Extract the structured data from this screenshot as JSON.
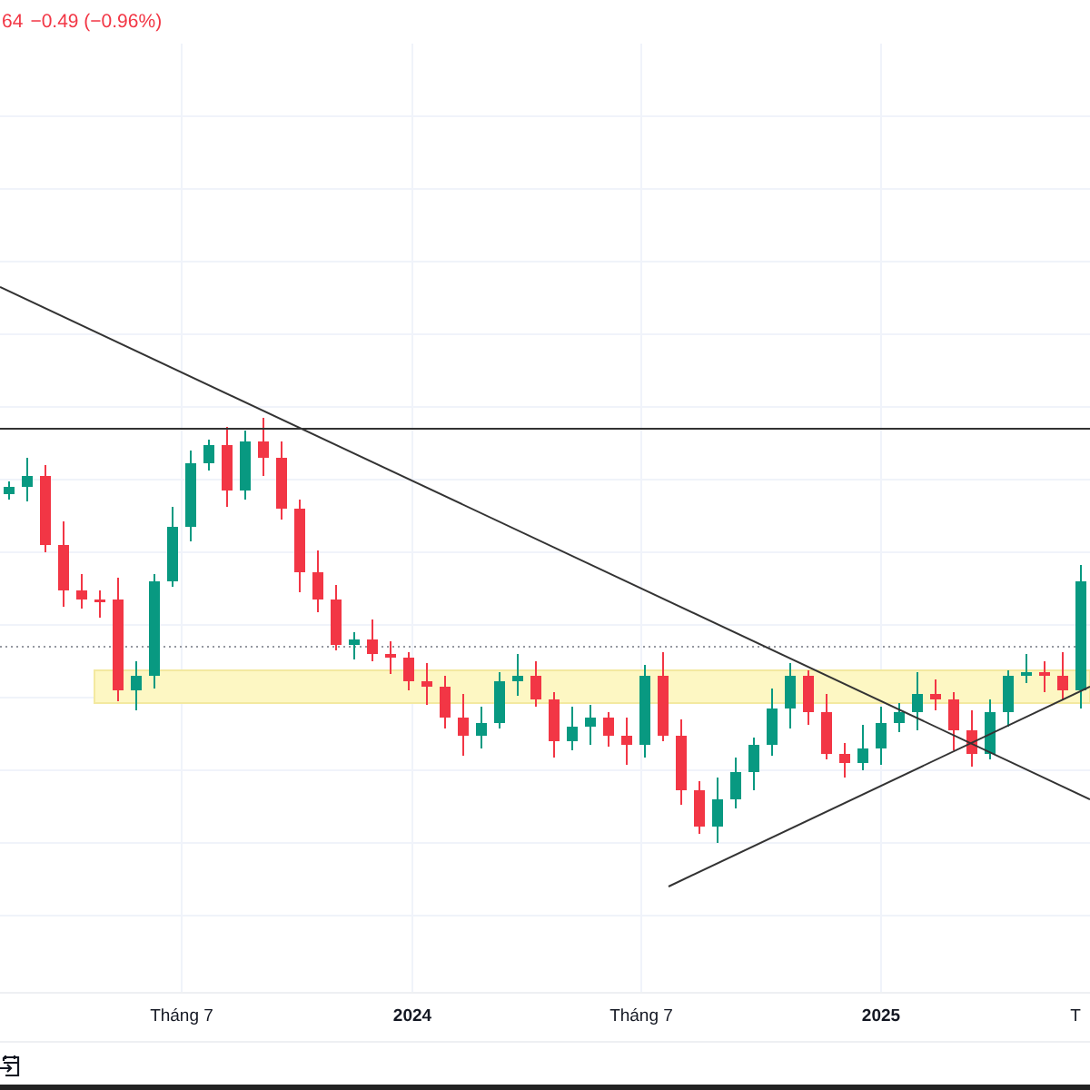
{
  "legend": {
    "value": "64",
    "change": "−0.49 (−0.96%)"
  },
  "time_axis": [
    {
      "label": "Tháng 7",
      "kind": "month"
    },
    {
      "label": "2024",
      "kind": "year"
    },
    {
      "label": "Tháng 7",
      "kind": "month"
    },
    {
      "label": "2025",
      "kind": "year"
    },
    {
      "label": "T",
      "kind": "month"
    }
  ]
}
